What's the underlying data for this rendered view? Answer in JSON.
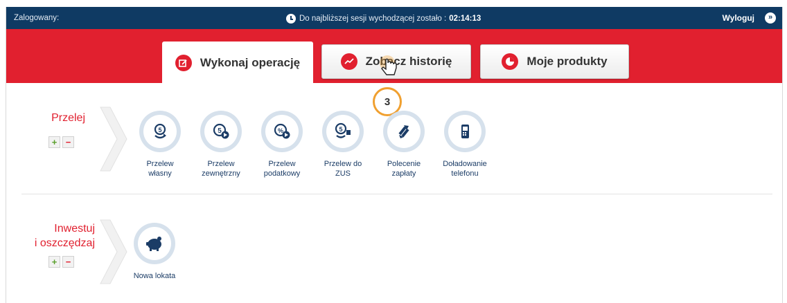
{
  "topbar": {
    "logged_label": "Zalogowany:",
    "session_label": "Do najbliższej sesji wychodzącej zostało :",
    "session_time": "02:14:13",
    "logout_label": "Wyloguj"
  },
  "tabs": [
    {
      "label": "Wykonaj operację",
      "icon": "edit-icon"
    },
    {
      "label": "Zobacz historię",
      "icon": "trend-icon"
    },
    {
      "label": "Moje produkty",
      "icon": "pie-chart-icon"
    }
  ],
  "step_marker": "3",
  "sections": [
    {
      "title_lines": [
        "Przelej"
      ],
      "operations": [
        {
          "label_lines": [
            "Przelew",
            "własny"
          ],
          "icon": "own-transfer-icon"
        },
        {
          "label_lines": [
            "Przelew",
            "zewnętrzny"
          ],
          "icon": "external-transfer-icon"
        },
        {
          "label_lines": [
            "Przelew",
            "podatkowy"
          ],
          "icon": "tax-transfer-icon"
        },
        {
          "label_lines": [
            "Przelew do",
            "ZUS"
          ],
          "icon": "zus-transfer-icon"
        },
        {
          "label_lines": [
            "Polecenie",
            "zapłaty"
          ],
          "icon": "direct-debit-icon"
        },
        {
          "label_lines": [
            "Doładowanie",
            "telefonu"
          ],
          "icon": "phone-topup-icon"
        }
      ]
    },
    {
      "title_lines": [
        "Inwestuj",
        "i oszczędzaj"
      ],
      "operations": [
        {
          "label_lines": [
            "Nowa lokata"
          ],
          "icon": "piggy-bank-icon"
        }
      ]
    }
  ],
  "colors": {
    "topbar": "#0f3a63",
    "brand_red": "#e1202f",
    "icon_blue": "#1b3c66",
    "step_orange": "#f0a030"
  }
}
